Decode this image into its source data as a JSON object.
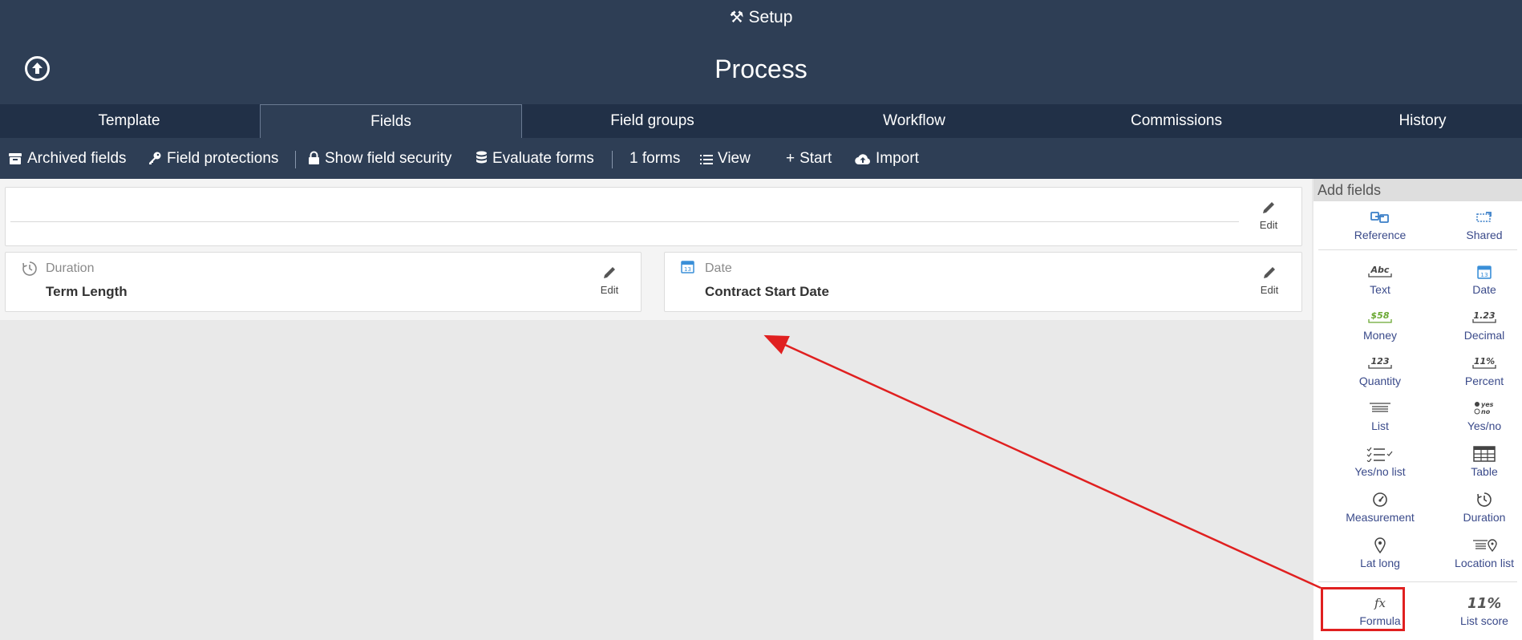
{
  "header": {
    "setup_label": "Setup",
    "title": "Process"
  },
  "tabs": [
    {
      "label": "Template"
    },
    {
      "label": "Fields"
    },
    {
      "label": "Field groups"
    },
    {
      "label": "Workflow"
    },
    {
      "label": "Commissions"
    },
    {
      "label": "History"
    }
  ],
  "active_tab": "Fields",
  "toolbar": {
    "archived": "Archived fields",
    "protections": "Field protections",
    "security": "Show field security",
    "evaluate": "Evaluate forms",
    "forms": "1 forms",
    "view": "View",
    "start": "Start",
    "import": "Import"
  },
  "form": {
    "edit_label": "Edit",
    "fields": [
      {
        "type": "Duration",
        "name": "Term Length",
        "icon": "duration-icon"
      },
      {
        "type": "Date",
        "name": "Contract Start Date",
        "icon": "calendar-icon"
      }
    ]
  },
  "sidebar": {
    "title": "Add fields",
    "items": [
      {
        "label": "Reference",
        "icon": "reference-icon"
      },
      {
        "label": "Shared",
        "icon": "shared-icon"
      },
      {
        "label": "Text",
        "icon": "text-icon",
        "glyph": "Abc"
      },
      {
        "label": "Date",
        "icon": "date-icon"
      },
      {
        "label": "Money",
        "icon": "money-icon",
        "glyph": "$58"
      },
      {
        "label": "Decimal",
        "icon": "decimal-icon",
        "glyph": "1.23"
      },
      {
        "label": "Quantity",
        "icon": "quantity-icon",
        "glyph": "123"
      },
      {
        "label": "Percent",
        "icon": "percent-icon",
        "glyph": "11%"
      },
      {
        "label": "List",
        "icon": "list-icon"
      },
      {
        "label": "Yes/no",
        "icon": "yes-no-icon",
        "glyph_yes": "yes",
        "glyph_no": "no"
      },
      {
        "label": "Yes/no list",
        "icon": "yes-no-list-icon"
      },
      {
        "label": "Table",
        "icon": "table-icon"
      },
      {
        "label": "Measurement",
        "icon": "measurement-icon"
      },
      {
        "label": "Duration",
        "icon": "duration-icon"
      },
      {
        "label": "Lat long",
        "icon": "map-pin-icon"
      },
      {
        "label": "Location list",
        "icon": "location-list-icon"
      },
      {
        "label": "Formula",
        "icon": "formula-icon",
        "glyph": "fx"
      },
      {
        "label": "List score",
        "icon": "list-score-icon",
        "glyph": "11%"
      }
    ]
  },
  "colors": {
    "header_bg": "#2e3e55",
    "tabs_bg": "#213047",
    "link": "#3a4a8a",
    "highlight": "#e02020",
    "money_green": "#6aa832",
    "date_blue": "#3a8fd8"
  }
}
